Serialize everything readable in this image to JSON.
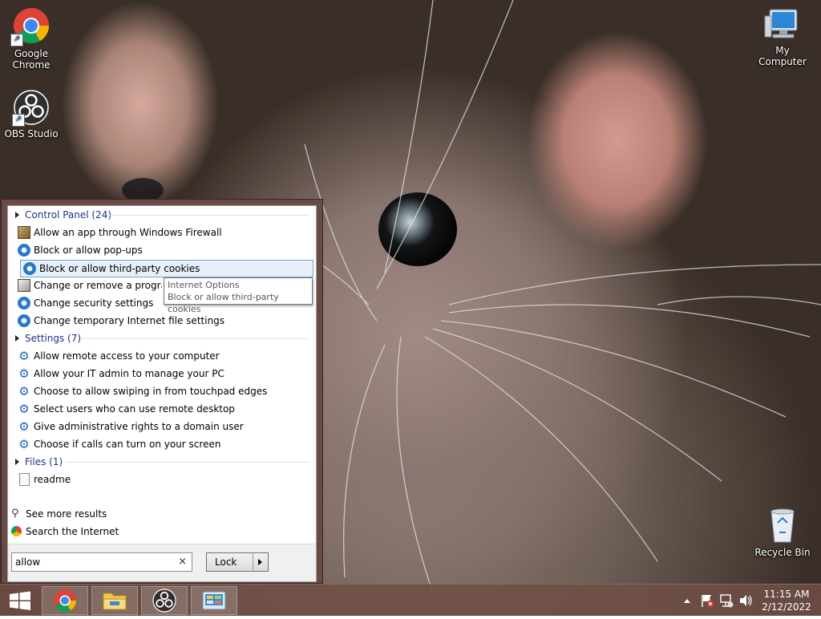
{
  "desktop": {
    "icons": [
      {
        "label": "Google\nChrome",
        "icon": "chrome-icon"
      },
      {
        "label": "OBS Studio",
        "icon": "obs-icon"
      },
      {
        "label": "My Computer",
        "icon": "computer-icon"
      },
      {
        "label": "Recycle Bin",
        "icon": "recycle-bin-icon"
      }
    ]
  },
  "start_menu": {
    "categories": [
      {
        "title": "Control Panel (24)",
        "items": [
          {
            "label": "Allow an app through Windows Firewall",
            "icon": "firewall-icon"
          },
          {
            "label": "Block or allow pop-ups",
            "icon": "internet-options-icon"
          },
          {
            "label": "Block or allow third-party cookies",
            "icon": "internet-options-icon",
            "selected": true
          },
          {
            "label": "Change or remove a program",
            "icon": "programs-icon"
          },
          {
            "label": "Change security settings",
            "icon": "internet-options-icon"
          },
          {
            "label": "Change temporary Internet file settings",
            "icon": "internet-options-icon"
          }
        ]
      },
      {
        "title": "Settings (7)",
        "items": [
          {
            "label": "Allow remote access to your computer",
            "icon": "gear-icon"
          },
          {
            "label": "Allow your IT admin to manage your PC",
            "icon": "gear-icon"
          },
          {
            "label": "Choose to allow swiping in from touchpad edges",
            "icon": "gear-icon"
          },
          {
            "label": "Select users who can use remote desktop",
            "icon": "gear-icon"
          },
          {
            "label": "Give administrative rights to a domain user",
            "icon": "gear-icon"
          },
          {
            "label": "Choose if calls can turn on your screen",
            "icon": "gear-icon"
          }
        ]
      },
      {
        "title": "Files (1)",
        "items": [
          {
            "label": "readme",
            "icon": "text-file-icon"
          }
        ]
      }
    ],
    "tooltip": {
      "title": "Internet Options",
      "text": "Block or allow third-party cookies"
    },
    "see_more": "See more results",
    "search_internet": "Search the Internet",
    "search": {
      "value": "allow",
      "clear_symbol": "×"
    },
    "power_button": "Lock"
  },
  "taskbar": {
    "pinned": [
      "chrome-icon",
      "file-explorer-icon",
      "obs-icon",
      "control-panel-icon"
    ],
    "clock": {
      "time": "11:15 AM",
      "date": "2/12/2022"
    }
  }
}
